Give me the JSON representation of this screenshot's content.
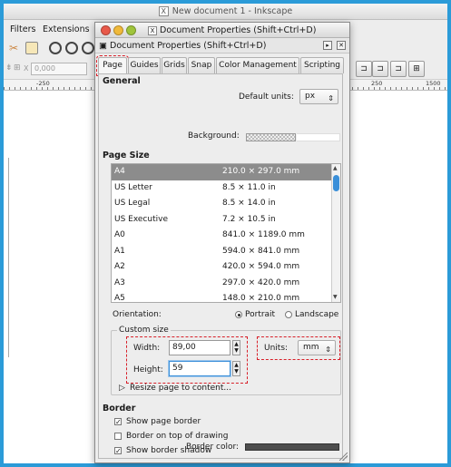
{
  "main_window": {
    "title": "New document 1 - Inkscape",
    "menus": [
      "Filters",
      "Extensions"
    ],
    "coord_x_placeholder": "0,000",
    "coord_x_label": "X",
    "ruler_labels": [
      "-250",
      "250",
      "1500"
    ]
  },
  "dialog": {
    "title": "Document Properties (Shift+Ctrl+D)",
    "subtitle": "Document Properties (Shift+Ctrl+D)",
    "tabs": [
      "Page",
      "Guides",
      "Grids",
      "Snap",
      "Color Management",
      "Scripting"
    ],
    "active_tab": "Page",
    "general": {
      "heading": "General",
      "default_units_label": "Default units:",
      "default_units_value": "px",
      "background_label": "Background:"
    },
    "page_size": {
      "heading": "Page Size",
      "rows": [
        {
          "name": "A4",
          "dims": "210.0 × 297.0 mm"
        },
        {
          "name": "US Letter",
          "dims": "8.5 × 11.0 in"
        },
        {
          "name": "US Legal",
          "dims": "8.5 × 14.0 in"
        },
        {
          "name": "US Executive",
          "dims": "7.2 × 10.5 in"
        },
        {
          "name": "A0",
          "dims": "841.0 × 1189.0 mm"
        },
        {
          "name": "A1",
          "dims": "594.0 × 841.0 mm"
        },
        {
          "name": "A2",
          "dims": "420.0 × 594.0 mm"
        },
        {
          "name": "A3",
          "dims": "297.0 × 420.0 mm"
        },
        {
          "name": "A5",
          "dims": "148.0 × 210.0 mm"
        }
      ],
      "orientation_label": "Orientation:",
      "portrait_label": "Portrait",
      "landscape_label": "Landscape",
      "custom_size_label": "Custom size",
      "width_label": "Width:",
      "width_value": "89,00",
      "height_label": "Height:",
      "height_value": "59",
      "units_label": "Units:",
      "units_value": "mm",
      "resize_label": "Resize page to content..."
    },
    "border": {
      "heading": "Border",
      "show_border_label": "Show page border",
      "show_border_checked": true,
      "border_on_top_label": "Border on top of drawing",
      "border_on_top_checked": false,
      "show_shadow_label": "Show border shadow",
      "show_shadow_checked": true,
      "border_color_label": "Border color:",
      "border_color": "#4d4d4d"
    }
  },
  "colors": {
    "frame": "#2b9bd8",
    "highlight": "#d8202a",
    "selection": "#8c8c8c",
    "focus": "#3a8fd9"
  }
}
